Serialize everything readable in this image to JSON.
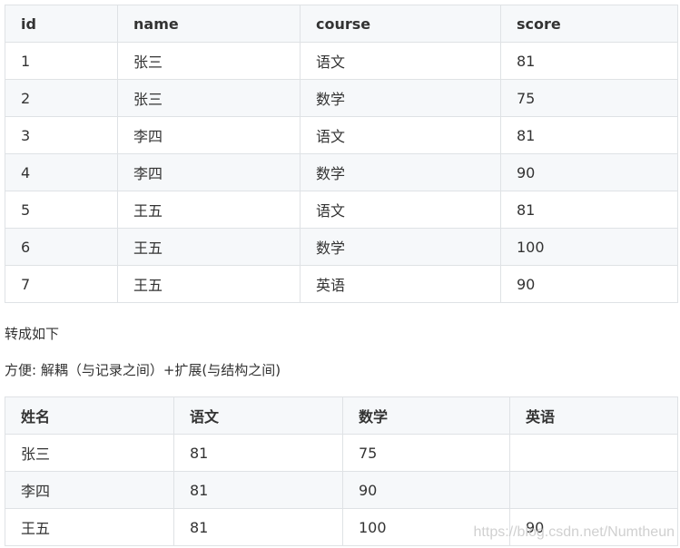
{
  "table1": {
    "headers": [
      "id",
      "name",
      "course",
      "score"
    ],
    "rows": [
      [
        "1",
        "张三",
        "语文",
        "81"
      ],
      [
        "2",
        "张三",
        "数学",
        "75"
      ],
      [
        "3",
        "李四",
        "语文",
        "81"
      ],
      [
        "4",
        "李四",
        "数学",
        "90"
      ],
      [
        "5",
        "王五",
        "语文",
        "81"
      ],
      [
        "6",
        "王五",
        "数学",
        "100"
      ],
      [
        "7",
        "王五",
        "英语",
        "90"
      ]
    ]
  },
  "paragraph1": "转成如下",
  "paragraph2": "方便: 解耦（与记录之间）+扩展(与结构之间)",
  "table2": {
    "headers": [
      "姓名",
      "语文",
      "数学",
      "英语"
    ],
    "rows": [
      [
        "张三",
        "81",
        "75",
        ""
      ],
      [
        "李四",
        "81",
        "90",
        ""
      ],
      [
        "王五",
        "81",
        "100",
        "90"
      ]
    ]
  },
  "watermark": "https://blog.csdn.net/Numtheun"
}
